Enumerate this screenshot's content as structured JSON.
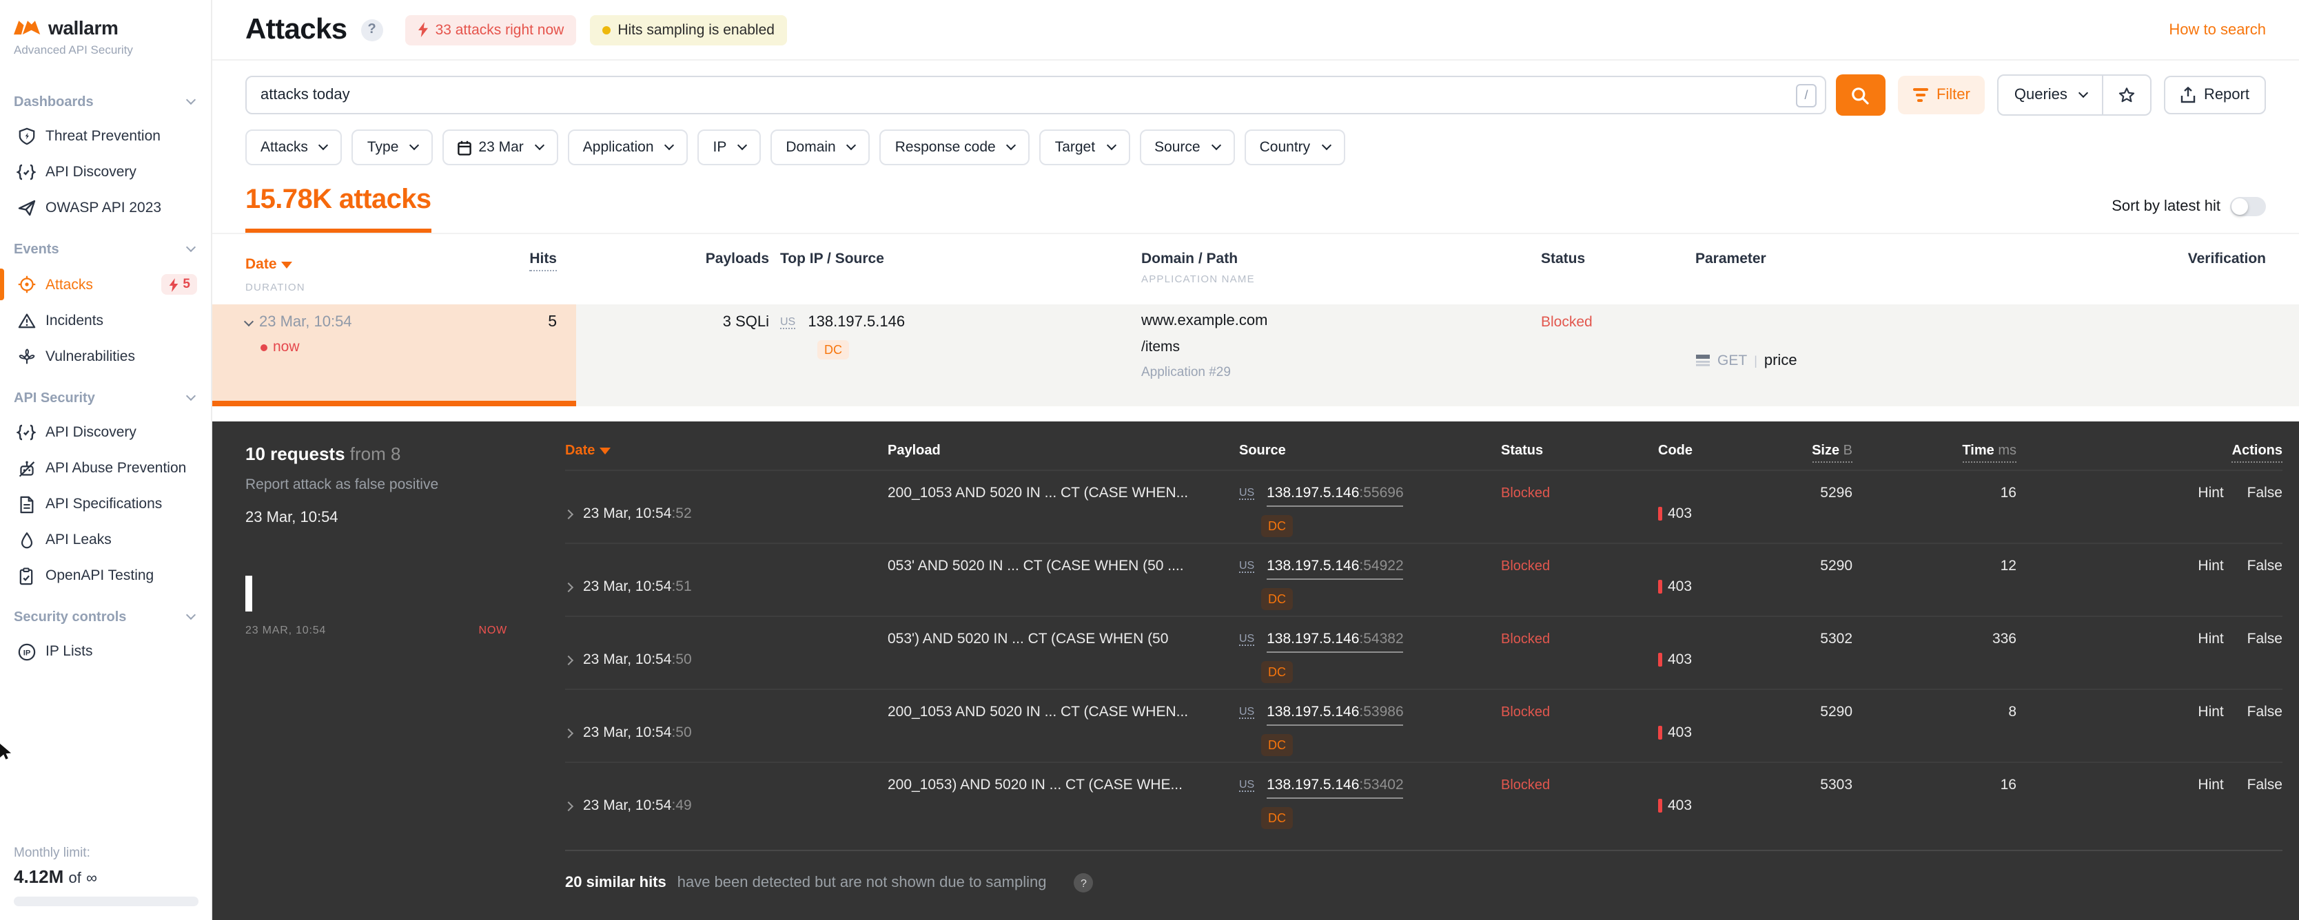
{
  "colors": {
    "accent": "#f7750c",
    "danger": "#e5484d",
    "warning_dot": "#edb80c",
    "dark_bg": "#343434",
    "row_selected_bg": "#fbe3d1"
  },
  "sidebar": {
    "logo": "wallarm",
    "subtitle": "Advanced API Security",
    "sections": [
      {
        "label": "Dashboards",
        "items": [
          {
            "icon": "shield-check-icon",
            "label": "Threat Prevention"
          },
          {
            "icon": "braces-icon",
            "label": "API Discovery"
          },
          {
            "icon": "paper-plane-icon",
            "label": "OWASP API 2023"
          }
        ]
      },
      {
        "label": "Events",
        "items": [
          {
            "icon": "target-icon",
            "label": "Attacks",
            "active": true,
            "badge": "5"
          },
          {
            "icon": "warning-icon",
            "label": "Incidents"
          },
          {
            "icon": "rotor-icon",
            "label": "Vulnerabilities"
          }
        ]
      },
      {
        "label": "API Security",
        "items": [
          {
            "icon": "braces-icon",
            "label": "API Discovery"
          },
          {
            "icon": "robot-slash-icon",
            "label": "API Abuse Prevention"
          },
          {
            "icon": "document-icon",
            "label": "API Specifications"
          },
          {
            "icon": "droplet-icon",
            "label": "API Leaks"
          },
          {
            "icon": "clipboard-check-icon",
            "label": "OpenAPI Testing"
          }
        ]
      },
      {
        "label": "Security controls",
        "items": [
          {
            "icon": "ip-icon",
            "label": "IP Lists"
          }
        ]
      }
    ],
    "monthly_limit_label": "Monthly limit:",
    "monthly_limit_value": "4.12M",
    "monthly_limit_of": "of",
    "monthly_limit_total": "∞"
  },
  "header": {
    "title": "Attacks",
    "help_icon": "?",
    "live_badge": "33 attacks right now",
    "sampling_badge": "Hits sampling is enabled",
    "help_link": "How to search"
  },
  "search": {
    "value": "attacks today",
    "shortcut": "/",
    "filter_label": "Filter",
    "queries_label": "Queries",
    "report_label": "Report"
  },
  "filters": [
    {
      "label": "Attacks"
    },
    {
      "label": "Type"
    },
    {
      "label": "23 Mar",
      "icon": "calendar-icon"
    },
    {
      "label": "Application"
    },
    {
      "label": "IP"
    },
    {
      "label": "Domain"
    },
    {
      "label": "Response code"
    },
    {
      "label": "Target"
    },
    {
      "label": "Source"
    },
    {
      "label": "Country"
    }
  ],
  "summary": {
    "count": "15.78K attacks",
    "sort_label": "Sort by latest hit"
  },
  "table": {
    "headers": {
      "date": "Date",
      "duration": "DURATION",
      "hits": "Hits",
      "payloads": "Payloads",
      "top_ip": "Top IP / Source",
      "domain": "Domain / Path",
      "app_name": "APPLICATION NAME",
      "status": "Status",
      "parameter": "Parameter",
      "verification": "Verification"
    },
    "attack_row": {
      "date": "23 Mar, 10:54",
      "live": "now",
      "hits": "5",
      "payloads": "3 SQLi",
      "country": "US",
      "ip": "138.197.5.146",
      "datacenter": "DC",
      "domain": "www.example.com",
      "path": "/items",
      "application": "Application #29",
      "status": "Blocked",
      "method": "GET",
      "parameter": "price"
    }
  },
  "panel": {
    "requests_bold": "10 requests",
    "requests_rest": "from 8",
    "report_link": "Report attack as false positive",
    "time": "23 Mar, 10:54",
    "hist_start": "23 MAR, 10:54",
    "hist_now": "NOW",
    "headers": {
      "date": "Date",
      "payload": "Payload",
      "source": "Source",
      "status": "Status",
      "code": "Code",
      "size": "Size",
      "size_unit": "B",
      "time": "Time",
      "time_unit": "ms",
      "actions": "Actions"
    },
    "rows": [
      {
        "date": "23 Mar, 10:54",
        "sec": ":52",
        "payload": "200_1053 AND 5020 IN ... CT (CASE WHEN...",
        "country": "US",
        "ip": "138.197.5.146",
        "port": ":55696",
        "dc": "DC",
        "status": "Blocked",
        "code": "403",
        "size": "5296",
        "time": "16",
        "hint": "Hint",
        "false_label": "False"
      },
      {
        "date": "23 Mar, 10:54",
        "sec": ":51",
        "payload": "053' AND 5020 IN ... CT (CASE WHEN (50 ....",
        "country": "US",
        "ip": "138.197.5.146",
        "port": ":54922",
        "dc": "DC",
        "status": "Blocked",
        "code": "403",
        "size": "5290",
        "time": "12",
        "hint": "Hint",
        "false_label": "False"
      },
      {
        "date": "23 Mar, 10:54",
        "sec": ":50",
        "payload": "053') AND 5020 IN ... CT (CASE WHEN (50",
        "country": "US",
        "ip": "138.197.5.146",
        "port": ":54382",
        "dc": "DC",
        "status": "Blocked",
        "code": "403",
        "size": "5302",
        "time": "336",
        "hint": "Hint",
        "false_label": "False"
      },
      {
        "date": "23 Mar, 10:54",
        "sec": ":50",
        "payload": "200_1053 AND 5020 IN ... CT (CASE WHEN...",
        "country": "US",
        "ip": "138.197.5.146",
        "port": ":53986",
        "dc": "DC",
        "status": "Blocked",
        "code": "403",
        "size": "5290",
        "time": "8",
        "hint": "Hint",
        "false_label": "False"
      },
      {
        "date": "23 Mar, 10:54",
        "sec": ":49",
        "payload": "200_1053) AND 5020 IN ... CT (CASE WHE...",
        "country": "US",
        "ip": "138.197.5.146",
        "port": ":53402",
        "dc": "DC",
        "status": "Blocked",
        "code": "403",
        "size": "5303",
        "time": "16",
        "hint": "Hint",
        "false_label": "False"
      }
    ],
    "similar_bold": "20 similar hits",
    "similar_rest": "have been detected but are not shown due to sampling",
    "similar_help": "?"
  }
}
